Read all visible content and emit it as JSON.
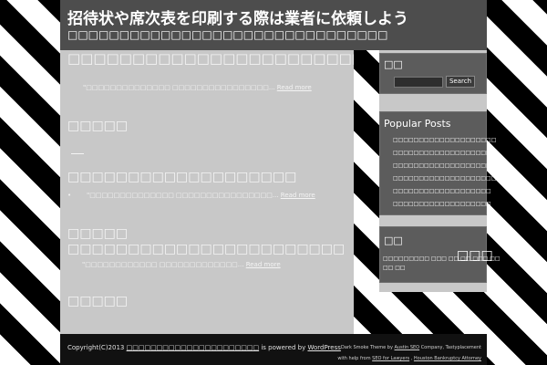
{
  "header": {
    "title": "招待状や席次表を印刷する際は業者に依頼しよう",
    "description": "□□□□□□□□□□□□□□□□□□□□□□□□□□□□□□□"
  },
  "posts": [
    {
      "title": "□□□□□□□□□□□□□□□□□□□□□□□□□□□□□□□□□□□□□□□□□□□□□□□",
      "excerpt": "\"□□□□□□□□□□□□□□ □□□□□□□□□□□□□□□□...",
      "more": "Read more"
    },
    {
      "title": "□□□□□"
    },
    {
      "title": "□□□□□□□□□□□□□□□□□□□",
      "bullet": "•",
      "excerpt": "\"□□□□□□□□□□□□□□ □□□□□□□□□□□□□□□□...",
      "more": "Read more"
    },
    {
      "title": "□□□□□\n□□□□□□□□□□□□□□□□□□□□□□□",
      "excerpt": "\"□□□□□□□□□□□□ □□□□□□□□□□□□□...",
      "more": "Read more"
    },
    {
      "title": "□□□□□"
    }
  ],
  "sidebar": {
    "search_title": "□□",
    "search_button": "Search",
    "popular_title": "Popular Posts",
    "popular_items": [
      "□□□□□□□□□□□□□□□□□□□□",
      "□□□□□□□□□□□□□□□□□□□",
      "□□□□□□□□□□□□□□□□□□□",
      "□□□□□□□□□□□□□□□□□□□□□□□□",
      "□□□□□□□□□□□□□□□□□□□",
      "□□□□□□□□□□□□□□□□□□□"
    ],
    "tags_title": "□□",
    "tags_small": "□□□□□□□□□ □□□ □□ □□ □□□ □□",
    "tags_large": "□□□",
    "tags_line2": "□□ □□"
  },
  "footer": {
    "copyright_prefix": "Copyright(C)2013",
    "site_link": "□□□□□□□□□□□□□□□□□□□□□□",
    "powered": "is powered by",
    "wordpress": "WordPress",
    "theme_prefix": "Dark Smoke Theme by",
    "austin_seo": "Austin SEO",
    "company": "Company, Tastyplacement",
    "help_prefix": "with help from",
    "seo_lawyers": "SEO for Lawyers",
    "houston": "Houston Bankruptcy Attorney"
  },
  "colors": {
    "stripe_dark": "#000000",
    "stripe_light": "#ffffff",
    "header_bg": "#4d4d4d",
    "main_bg": "#c8c8c8",
    "widget_bg": "#5c5c5c",
    "footer_bg": "#111111"
  }
}
